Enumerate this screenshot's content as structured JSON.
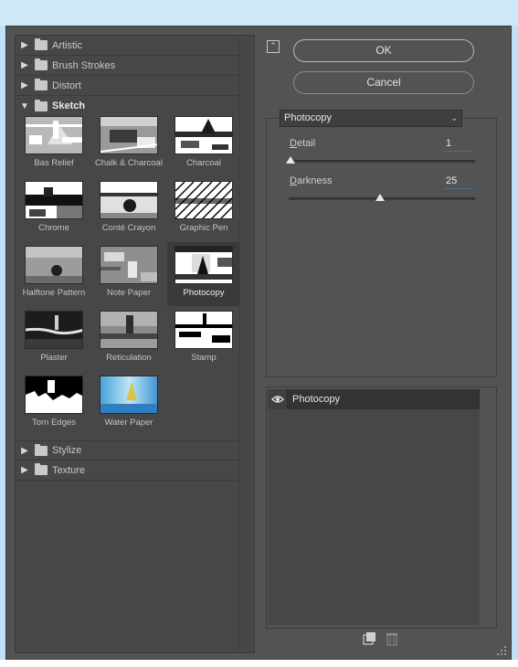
{
  "dialog": {
    "ok_label": "OK",
    "cancel_label": "Cancel"
  },
  "gallery": {
    "categories_top": [
      {
        "label": "Artistic",
        "open": false
      },
      {
        "label": "Brush Strokes",
        "open": false
      },
      {
        "label": "Distort",
        "open": false
      },
      {
        "label": "Sketch",
        "open": true
      }
    ],
    "categories_bottom": [
      {
        "label": "Stylize",
        "open": false
      },
      {
        "label": "Texture",
        "open": false
      }
    ],
    "sketch_filters": [
      {
        "label": "Bas Relief"
      },
      {
        "label": "Chalk & Charcoal"
      },
      {
        "label": "Charcoal"
      },
      {
        "label": "Chrome"
      },
      {
        "label": "Conté Crayon"
      },
      {
        "label": "Graphic Pen"
      },
      {
        "label": "Halftone Pattern"
      },
      {
        "label": "Note Paper"
      },
      {
        "label": "Photocopy",
        "selected": true
      },
      {
        "label": "Plaster"
      },
      {
        "label": "Reticulation"
      },
      {
        "label": "Stamp"
      },
      {
        "label": "Torn Edges"
      },
      {
        "label": "Water Paper"
      }
    ]
  },
  "settings": {
    "filter_select": "Photocopy",
    "detail_label_first": "D",
    "detail_label_rest": "etail",
    "detail_value": "1",
    "darkness_label_first": "D",
    "darkness_label_rest": "arkness",
    "darkness_value": "25"
  },
  "layers": {
    "active_layer": "Photocopy"
  },
  "icons": {
    "collapse": "collapse-up-icon",
    "eye": "eye-icon",
    "new_layer": "new-effect-layer-icon",
    "delete": "trash-icon",
    "folder": "folder-icon",
    "arrow": "triangle-right-icon",
    "resize": "resize-grip-icon"
  }
}
